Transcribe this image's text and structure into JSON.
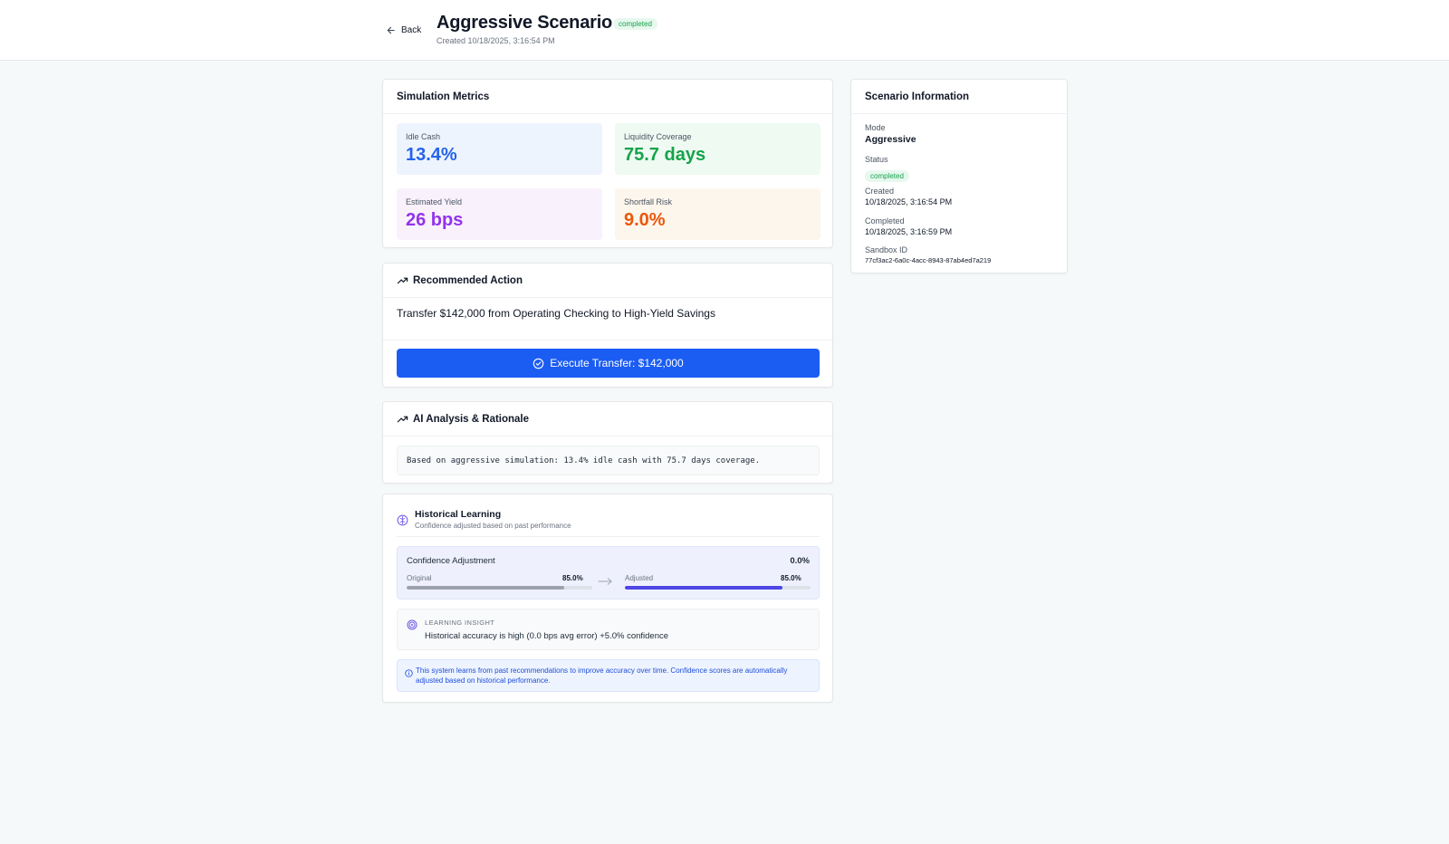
{
  "header": {
    "back_label": "Back",
    "title": "Aggressive Scenario",
    "status_badge": "completed",
    "created": "Created 10/18/2025, 3:16:54 PM"
  },
  "metrics_card": {
    "title": "Simulation Metrics",
    "items": [
      {
        "label": "Idle Cash",
        "value": "13.4%",
        "color": "#2563eb",
        "bg": "#eef4fd"
      },
      {
        "label": "Liquidity Coverage",
        "value": "75.7 days",
        "color": "#16a34a",
        "bg": "#eefaf2"
      },
      {
        "label": "Estimated Yield",
        "value": "26 bps",
        "color": "#9333ea",
        "bg": "#f9f2fd"
      },
      {
        "label": "Shortfall Risk",
        "value": "9.0%",
        "color": "#ea580c",
        "bg": "#fdf6ec"
      }
    ]
  },
  "action_card": {
    "title": "Recommended Action",
    "text": "Transfer $142,000 from Operating Checking to High-Yield Savings",
    "button_label": "Execute Transfer: $142,000"
  },
  "analysis_card": {
    "title": "AI Analysis & Rationale",
    "text": "Based on aggressive simulation: 13.4% idle cash with 75.7 days coverage."
  },
  "learning_card": {
    "title": "Historical Learning",
    "subtitle": "Confidence adjusted based on past performance",
    "confidence_title": "Confidence Adjustment",
    "confidence_delta": "0.0%",
    "original_label": "Original",
    "original_pct": "85.0%",
    "original_value": 0.85,
    "adjusted_label": "Adjusted",
    "adjusted_pct": "85.0%",
    "adjusted_value": 0.85,
    "insight_label": "LEARNING INSIGHT",
    "insight_text": "Historical accuracy is high (0.0 bps avg error) +5.0% confidence",
    "info_text": "This system learns from past recommendations to improve accuracy over time. Confidence scores are automatically adjusted based on historical performance."
  },
  "scenario_info": {
    "title": "Scenario Information",
    "mode_label": "Mode",
    "mode_value": "Aggressive",
    "status_label": "Status",
    "status_value": "completed",
    "created_label": "Created",
    "created_value": "10/18/2025, 3:16:54 PM",
    "completed_label": "Completed",
    "completed_value": "10/18/2025, 3:16:59 PM",
    "sandbox_label": "Sandbox ID",
    "sandbox_value": "77cf3ac2-6a0c-4acc-8943-87ab4ed7a219"
  },
  "icons": [
    "arrow-left-icon",
    "trending-up-icon",
    "check-circle-icon",
    "brain-icon",
    "arrow-right-icon",
    "target-icon",
    "info-icon"
  ]
}
